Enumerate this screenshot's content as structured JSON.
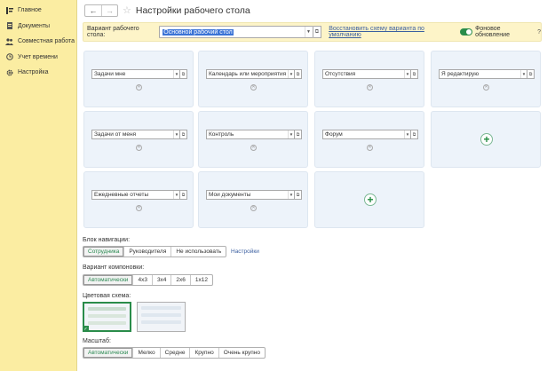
{
  "sidebar": {
    "items": [
      {
        "label": "Главное",
        "icon": "main-menu-icon"
      },
      {
        "label": "Документы",
        "icon": "documents-icon"
      },
      {
        "label": "Совместная работа",
        "icon": "collaboration-icon"
      },
      {
        "label": "Учет времени",
        "icon": "time-tracking-icon"
      },
      {
        "label": "Настройка",
        "icon": "settings-icon"
      }
    ]
  },
  "header": {
    "back_glyph": "←",
    "forward_glyph": "→",
    "title": "Настройки рабочего стола"
  },
  "variant_bar": {
    "label": "Вариант рабочего стола:",
    "value": "Основной рабочий стол",
    "restore_link": "Восстановить схему варианта по умолчанию",
    "toggle_label": "Фоновое обновление",
    "toggle_on": true,
    "help": "?"
  },
  "panels": [
    {
      "value": "Задачи мне"
    },
    {
      "value": "Календарь или мероприятия"
    },
    {
      "value": "Отсутствия"
    },
    {
      "value": "Я редактирую"
    },
    {
      "value": "Задачи от меня"
    },
    {
      "value": "Контроль"
    },
    {
      "value": "Форум"
    },
    {
      "value": ""
    },
    {
      "value": "Ежедневные отчеты"
    },
    {
      "value": "Мои документы"
    },
    {
      "value": ""
    }
  ],
  "nav_block": {
    "label": "Блок навигации:",
    "options": [
      "Сотрудника",
      "Руководителя",
      "Не использовать"
    ],
    "selected": "Сотрудника",
    "settings_link": "Настройки"
  },
  "layout_variant": {
    "label": "Вариант компоновки:",
    "options": [
      "Автоматически",
      "4x3",
      "3x4",
      "2x6",
      "1x12"
    ],
    "selected": "Автоматически"
  },
  "color_scheme": {
    "label": "Цветовая схема:"
  },
  "scale": {
    "label": "Масштаб:",
    "options": [
      "Автоматически",
      "Мелко",
      "Средне",
      "Крупно",
      "Очень крупно"
    ],
    "selected": "Автоматически"
  },
  "colors": {
    "sidebar_bg": "#fbeda2",
    "accent_green": "#2a8c4a",
    "link_blue": "#3b5fa0",
    "panel_bg": "#edf3fa"
  }
}
